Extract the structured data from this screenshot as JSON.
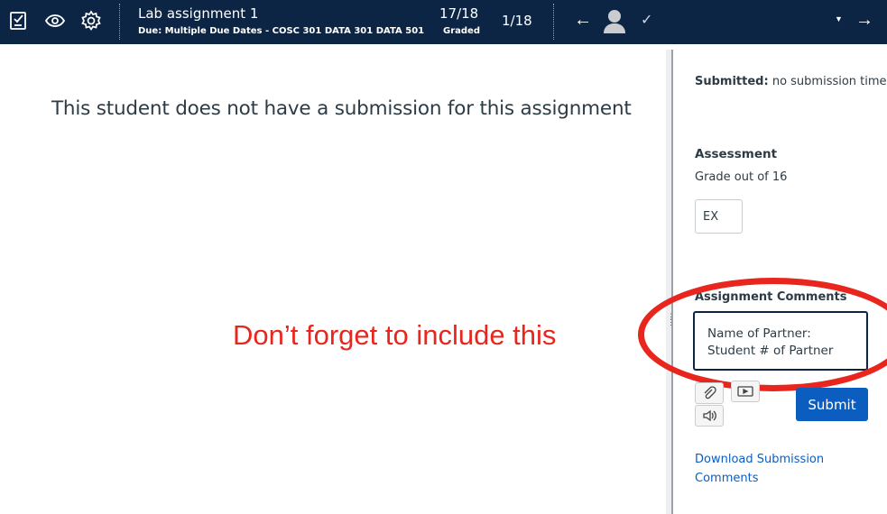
{
  "header": {
    "title": "Lab assignment 1",
    "due": "Due: Multiple Due Dates - COSC 301 DATA 301 DATA 501",
    "graded_count": "17/18",
    "graded_label": "Graded",
    "student_position": "1/18",
    "icons": [
      "gradebook-icon",
      "eye-icon",
      "gear-icon",
      "arrow-left-icon",
      "avatar-icon",
      "check-icon",
      "dropdown-icon",
      "arrow-right-icon"
    ]
  },
  "main": {
    "message": "This student does not have a submission for this assignment",
    "annotation": "Don’t forget to include this"
  },
  "sidebar": {
    "submitted_label": "Submitted:",
    "submitted_value": "no submission time",
    "assessment_heading": "Assessment",
    "grade_out_of": "Grade out of 16",
    "grade_value": "EX",
    "comments_heading": "Assignment Comments",
    "comment_text": "Name of Partner:\nStudent # of Partner",
    "submit_label": "Submit",
    "download_label": "Download Submission Comments"
  },
  "colors": {
    "topbar": "#0d2545",
    "annotation": "#e8261d",
    "link": "#0b5ec0",
    "submit": "#0b5ec0"
  }
}
